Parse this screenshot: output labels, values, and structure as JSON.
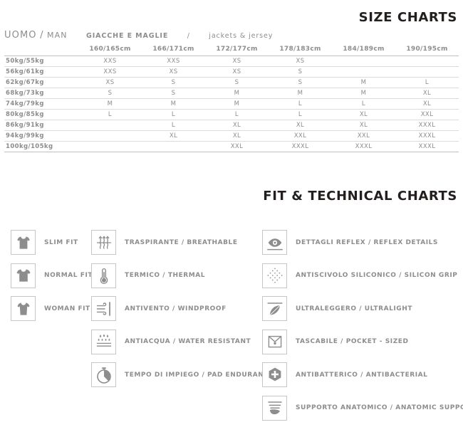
{
  "titles": {
    "size_charts": "SIZE CHARTS",
    "fit_charts": "FIT & TECHNICAL CHARTS"
  },
  "section_header": {
    "gender_it": "UOMO",
    "separator": "/",
    "gender_en": "MAN",
    "category_it": "GIACCHE E MAGLIE",
    "category_sep": "/",
    "category_en": "jackets & jersey"
  },
  "size_table": {
    "corner": "",
    "columns": [
      "160/165cm",
      "166/171cm",
      "172/177cm",
      "178/183cm",
      "184/189cm",
      "190/195cm"
    ],
    "rows": [
      {
        "weight": "50kg/55kg",
        "sizes": [
          "XXS",
          "XXS",
          "XS",
          "XS",
          "",
          ""
        ]
      },
      {
        "weight": "56kg/61kg",
        "sizes": [
          "XXS",
          "XS",
          "XS",
          "S",
          "",
          ""
        ]
      },
      {
        "weight": "62kg/67kg",
        "sizes": [
          "XS",
          "S",
          "S",
          "S",
          "M",
          "L"
        ]
      },
      {
        "weight": "68kg/73kg",
        "sizes": [
          "S",
          "S",
          "M",
          "M",
          "M",
          "XL"
        ]
      },
      {
        "weight": "74kg/79kg",
        "sizes": [
          "M",
          "M",
          "M",
          "L",
          "L",
          "XL"
        ]
      },
      {
        "weight": "80kg/85kg",
        "sizes": [
          "L",
          "L",
          "L",
          "L",
          "XL",
          "XXL"
        ]
      },
      {
        "weight": "86kg/91kg",
        "sizes": [
          "",
          "L",
          "XL",
          "XL",
          "XL",
          "XXXL"
        ]
      },
      {
        "weight": "94kg/99kg",
        "sizes": [
          "",
          "XL",
          "XL",
          "XXL",
          "XXL",
          "XXXL"
        ]
      },
      {
        "weight": "100kg/105kg",
        "sizes": [
          "",
          "",
          "XXL",
          "XXXL",
          "XXXL",
          "XXXL"
        ]
      }
    ]
  },
  "fit_column": [
    {
      "icon": "tshirt-slim-icon",
      "label": "SLIM FIT"
    },
    {
      "icon": "tshirt-normal-icon",
      "label": "NORMAL FIT"
    },
    {
      "icon": "tshirt-woman-icon",
      "label": "WOMAN FIT"
    }
  ],
  "technical_column_middle": [
    {
      "icon": "breathable-icon",
      "label": "TRASPIRANTE / BREATHABLE"
    },
    {
      "icon": "thermometer-icon",
      "label": "TERMICO / THERMAL"
    },
    {
      "icon": "windproof-icon",
      "label": "ANTIVENTO / WINDPROOF"
    },
    {
      "icon": "water-resistant-icon",
      "label": "ANTIACQUA / WATER RESISTANT"
    },
    {
      "icon": "stopwatch-icon",
      "label": "TEMPO DI IMPIEGO / PAD ENDURANCE"
    }
  ],
  "technical_column_right": [
    {
      "icon": "reflex-eye-icon",
      "label": "DETTAGLI REFLEX / REFLEX DETAILS"
    },
    {
      "icon": "silicon-grip-icon",
      "label": "ANTISCIVOLO SILICONICO / SILICON GRIP"
    },
    {
      "icon": "feather-icon",
      "label": "ULTRALEGGERO / ULTRALIGHT"
    },
    {
      "icon": "pocket-icon",
      "label": "TASCABILE / POCKET - SIZED"
    },
    {
      "icon": "antibacterial-icon",
      "label": "ANTIBATTERICO / ANTIBACTERIAL"
    },
    {
      "icon": "anatomic-support-icon",
      "label": "SUPPORTO ANATOMICO / ANATOMIC SUPPORT"
    }
  ],
  "colors": {
    "title": "#231f1e",
    "text": "#8d8d8d",
    "icon": "#8d8d8d",
    "border": "#c6c6c6",
    "rule": "#dcdcdc"
  }
}
